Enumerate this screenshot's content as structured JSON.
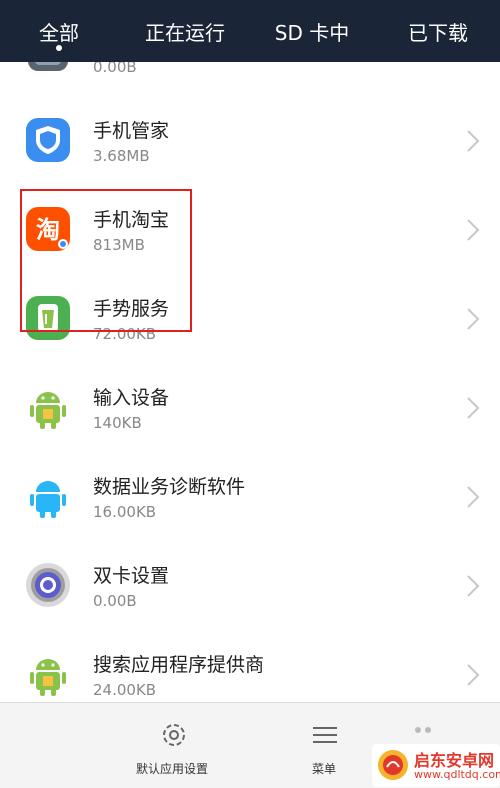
{
  "tabs": [
    {
      "label": "全部",
      "active": true
    },
    {
      "label": "正在运行"
    },
    {
      "label": "SD 卡中"
    },
    {
      "label": "已下载"
    }
  ],
  "apps": [
    {
      "name": "",
      "size": "0.00B",
      "icon": "partial-app-icon"
    },
    {
      "name": "手机管家",
      "size": "3.68MB",
      "icon": "phone-manager-icon"
    },
    {
      "name": "手机淘宝",
      "size": "813MB",
      "icon": "taobao-icon"
    },
    {
      "name": "手势服务",
      "size": "72.00KB",
      "icon": "gesture-service-icon"
    },
    {
      "name": "输入设备",
      "size": "140KB",
      "icon": "android-icon"
    },
    {
      "name": "数据业务诊断软件",
      "size": "16.00KB",
      "icon": "android-blue-icon"
    },
    {
      "name": "双卡设置",
      "size": "0.00B",
      "icon": "dual-sim-icon"
    },
    {
      "name": "搜索应用程序提供商",
      "size": "24.00KB",
      "icon": "android-icon"
    }
  ],
  "bottom_bar": {
    "default_app_settings": "默认应用设置",
    "menu": "菜单"
  },
  "watermark": {
    "title": "启东安卓网",
    "url": "www.qdltdq.com"
  },
  "colors": {
    "tabbar_bg": "#1a2537",
    "highlight": "#e02020",
    "taobao": "#ff5000",
    "android_green": "#8bc34a"
  }
}
